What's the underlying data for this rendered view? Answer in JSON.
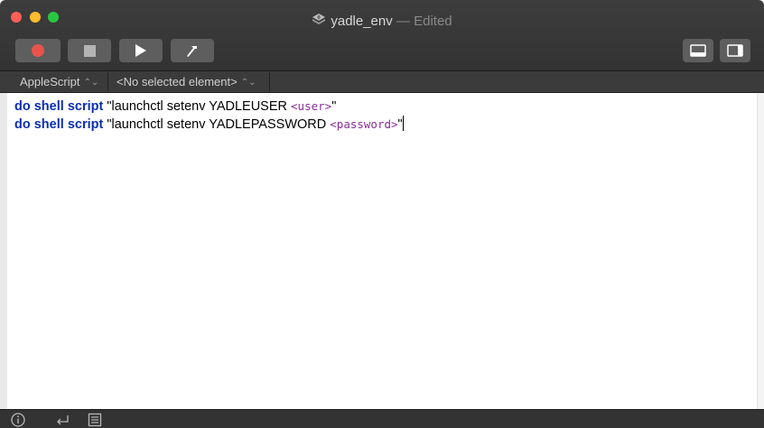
{
  "window": {
    "doc_icon": "applescript-document-icon",
    "name": "yadle_env",
    "separator": "—",
    "status": "Edited"
  },
  "toolbar": {
    "buttons": [
      {
        "name": "record",
        "icon": "record-icon"
      },
      {
        "name": "stop",
        "icon": "stop-icon"
      },
      {
        "name": "run",
        "icon": "play-icon"
      },
      {
        "name": "compile",
        "icon": "hammer-icon"
      }
    ],
    "right_buttons": [
      {
        "name": "show-bottom-pane",
        "icon": "bottom-pane-icon"
      },
      {
        "name": "show-side-pane",
        "icon": "side-pane-icon"
      }
    ]
  },
  "navbar": {
    "language": "AppleScript",
    "element": "<No selected element>"
  },
  "code": {
    "line1": {
      "keyword": "do shell script",
      "text": "\"launchctl setenv YADLEUSER ",
      "placeholder": "<user>",
      "end": "\""
    },
    "line2": {
      "keyword": "do shell script",
      "text": "\"launchctl setenv YADLEPASSWORD ",
      "placeholder": "<password>",
      "end": "\""
    }
  },
  "statusbar": {
    "icons": [
      "info-icon",
      "return-icon",
      "log-icon"
    ]
  },
  "colors": {
    "keyword": "#0b2fb0",
    "placeholder": "#8a2d9a",
    "record": "#e8544c",
    "close": "#fe5f57",
    "minimize": "#febc2e",
    "maximize": "#28c840"
  }
}
